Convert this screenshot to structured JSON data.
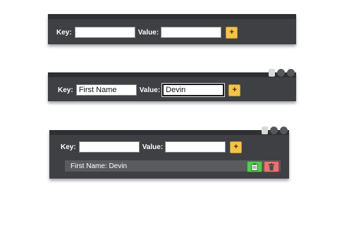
{
  "panels": [
    {
      "key_label": "Key:",
      "key_value": "",
      "value_label": "Value:",
      "value_value": "",
      "add_label": "+"
    },
    {
      "key_label": "Key:",
      "key_value": "First Name",
      "value_label": "Value:",
      "value_value": "Devin",
      "add_label": "+"
    },
    {
      "key_label": "Key:",
      "key_value": "",
      "value_label": "Value:",
      "value_value": "",
      "add_label": "+",
      "entry": "First Name: Devin"
    }
  ],
  "icons": {
    "copy": "clipboard-icon",
    "delete": "trash-icon"
  },
  "colors": {
    "panel": "#3e4043",
    "add_button": "#f3c44a",
    "copy_button": "#57c955",
    "delete_button": "#e57373"
  }
}
